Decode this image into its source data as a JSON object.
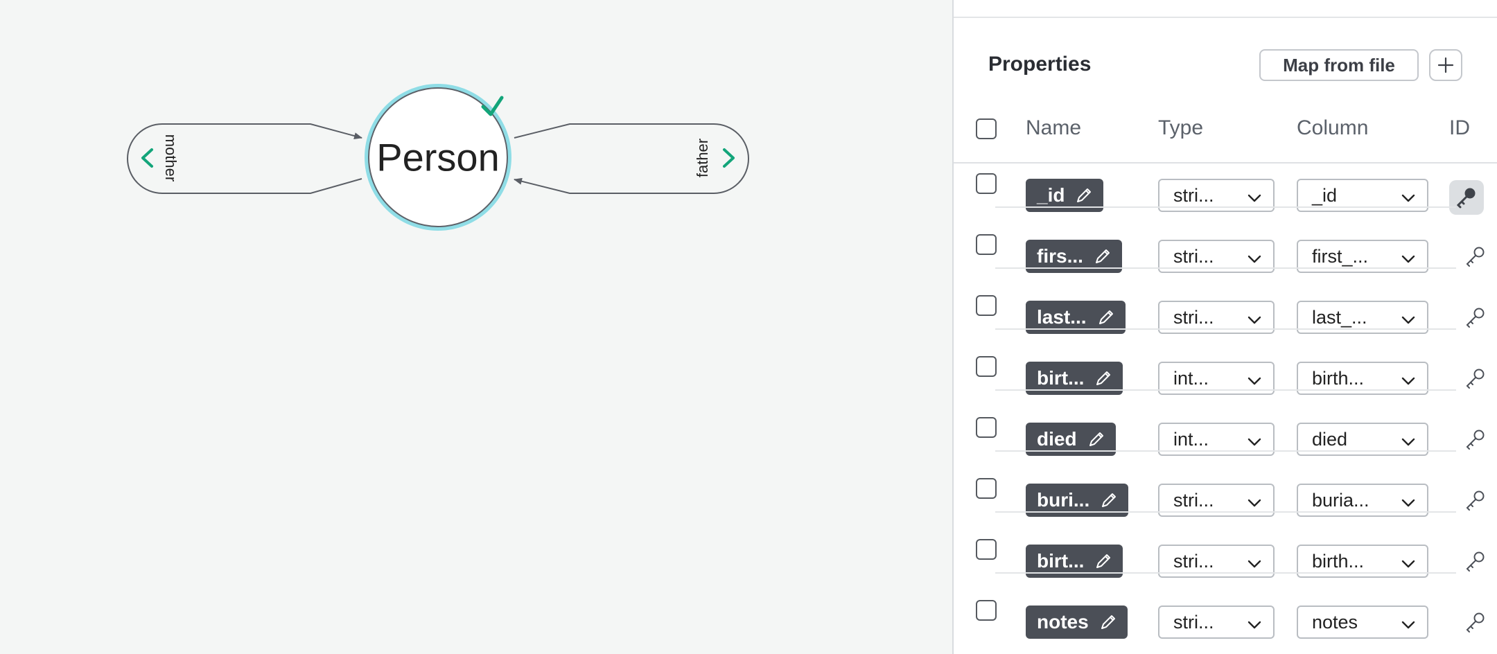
{
  "canvas": {
    "node": {
      "label": "Person",
      "checked": true,
      "ring_color": "#8fdde6",
      "check_color": "#13a57a"
    },
    "relationships": [
      {
        "label": "mother",
        "chevron": "chevron-left-icon"
      },
      {
        "label": "father",
        "chevron": "chevron-right-icon"
      }
    ]
  },
  "panel": {
    "title": "Properties",
    "map_from_file_label": "Map from file",
    "add_icon": "plus-icon",
    "headers": {
      "name": "Name",
      "type": "Type",
      "column": "Column",
      "id": "ID"
    },
    "rows": [
      {
        "name": "_id",
        "type": "stri...",
        "column": "_id",
        "is_id": true
      },
      {
        "name": "firs...",
        "type": "stri...",
        "column": "first_...",
        "is_id": false
      },
      {
        "name": "last...",
        "type": "stri...",
        "column": "last_...",
        "is_id": false
      },
      {
        "name": "birt...",
        "type": "int...",
        "column": "birth...",
        "is_id": false
      },
      {
        "name": "died",
        "type": "int...",
        "column": "died",
        "is_id": false
      },
      {
        "name": "buri...",
        "type": "stri...",
        "column": "buria...",
        "is_id": false
      },
      {
        "name": "birt...",
        "type": "stri...",
        "column": "birth...",
        "is_id": false
      },
      {
        "name": "notes",
        "type": "stri...",
        "column": "notes",
        "is_id": false
      }
    ]
  }
}
